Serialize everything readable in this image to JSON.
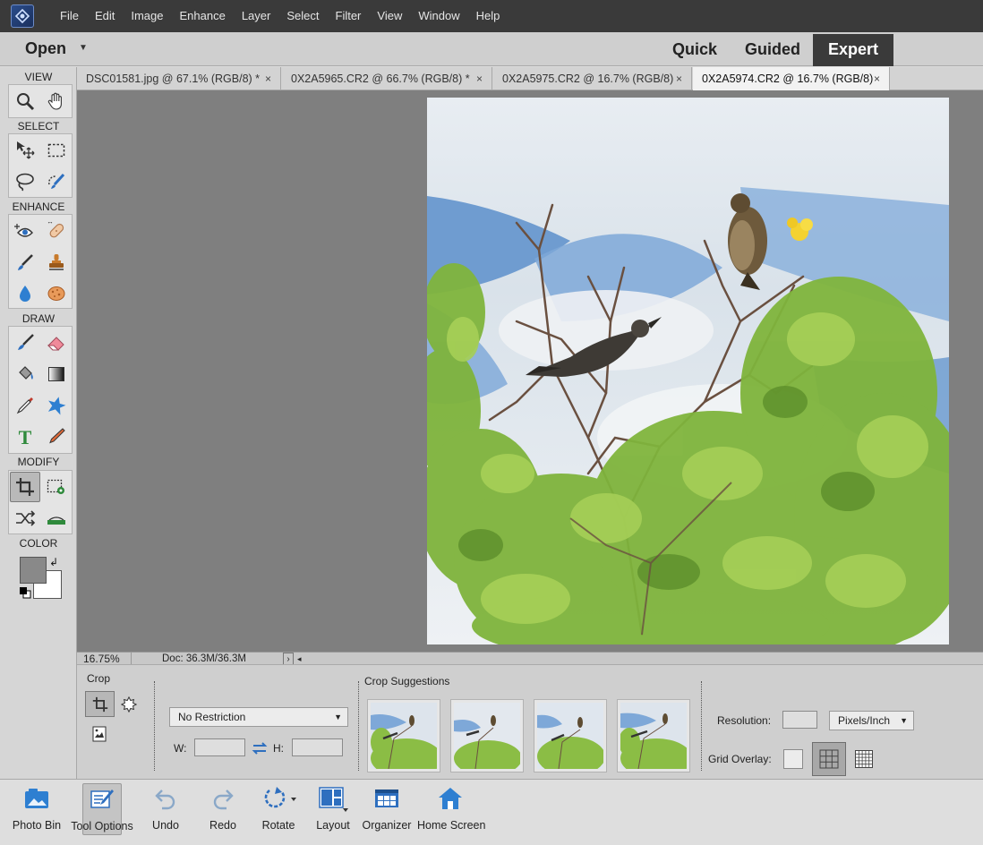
{
  "menu": [
    "File",
    "Edit",
    "Image",
    "Enhance",
    "Layer",
    "Select",
    "Filter",
    "View",
    "Window",
    "Help"
  ],
  "modebar": {
    "open_label": "Open",
    "modes": [
      "Quick",
      "Guided",
      "Expert"
    ],
    "active_mode": "Expert"
  },
  "toolbox": {
    "sections": [
      "VIEW",
      "SELECT",
      "ENHANCE",
      "DRAW",
      "MODIFY",
      "COLOR"
    ],
    "foreground_color": "#898989",
    "background_color": "#ffffff",
    "active_tool": "crop-tool"
  },
  "document_tabs": [
    {
      "title": "DSC01581.jpg @ 67.1% (RGB/8) *",
      "close": "×"
    },
    {
      "title": "0X2A5965.CR2 @ 66.7% (RGB/8) *",
      "close": "×"
    },
    {
      "title": "0X2A5975.CR2 @ 16.7% (RGB/8)",
      "close": "×"
    },
    {
      "title": "0X2A5974.CR2 @ 16.7% (RGB/8)",
      "close": "×"
    }
  ],
  "active_document_index": 3,
  "status": {
    "zoom": "16.75%",
    "doc_size": "Doc: 36.3M/36.3M",
    "arrow": "›",
    "scroll_left": "◂"
  },
  "tool_options": {
    "tool_name": "Crop",
    "aspect_dropdown": "No Restriction",
    "width_label": "W:",
    "height_label": "H:",
    "width_value": "",
    "height_value": "",
    "suggestions_label": "Crop Suggestions",
    "resolution_label": "Resolution:",
    "resolution_value": "",
    "resolution_unit": "Pixels/Inch",
    "grid_overlay_label": "Grid Overlay:",
    "grid_overlay_selected": "grid"
  },
  "taskbar": [
    {
      "label": "Photo Bin",
      "icon": "photo-bin-icon"
    },
    {
      "label": "Tool Options",
      "icon": "tool-options-icon"
    },
    {
      "label": "Undo",
      "icon": "undo-icon"
    },
    {
      "label": "Redo",
      "icon": "redo-icon"
    },
    {
      "label": "Rotate",
      "icon": "rotate-icon"
    },
    {
      "label": "Layout",
      "icon": "layout-icon"
    },
    {
      "label": "Organizer",
      "icon": "organizer-icon"
    },
    {
      "label": "Home Screen",
      "icon": "home-screen-icon"
    }
  ],
  "active_taskbar": "Tool Options"
}
